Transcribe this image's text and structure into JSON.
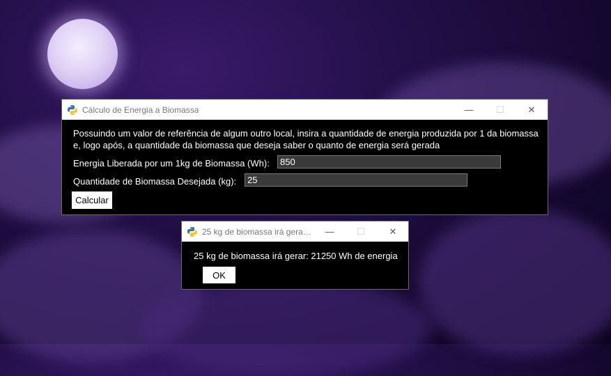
{
  "main_window": {
    "title": "Cálculo de Energia a Biomassa",
    "description_line1": "Possuindo um valor de referência de algum outro local, insira a quantidade de energia produzida por 1 da biomassa",
    "description_line2": "e, logo após, a quantidade da biomassa que deseja saber o quanto de energia será gerada",
    "energy_label": "Energia Liberada por um 1kg de Biomassa (Wh):",
    "energy_value": "850",
    "quantity_label": "Quantidade de Biomassa Desejada (kg):",
    "quantity_value": "25",
    "calculate_button": "Calcular"
  },
  "result_dialog": {
    "title": "25 kg de biomassa irá gerar: ...",
    "message": "25 kg de biomassa irá gerar: 21250 Wh de energia",
    "ok_button": "OK"
  },
  "window_controls": {
    "minimize": "—",
    "maximize": "☐",
    "close": "✕"
  },
  "icons": {
    "app": "python-icon",
    "background": "night-sky-moon-clouds"
  },
  "colors": {
    "sky": "#24104a",
    "window_bg": "#000000",
    "titlebar": "#ffffff"
  }
}
